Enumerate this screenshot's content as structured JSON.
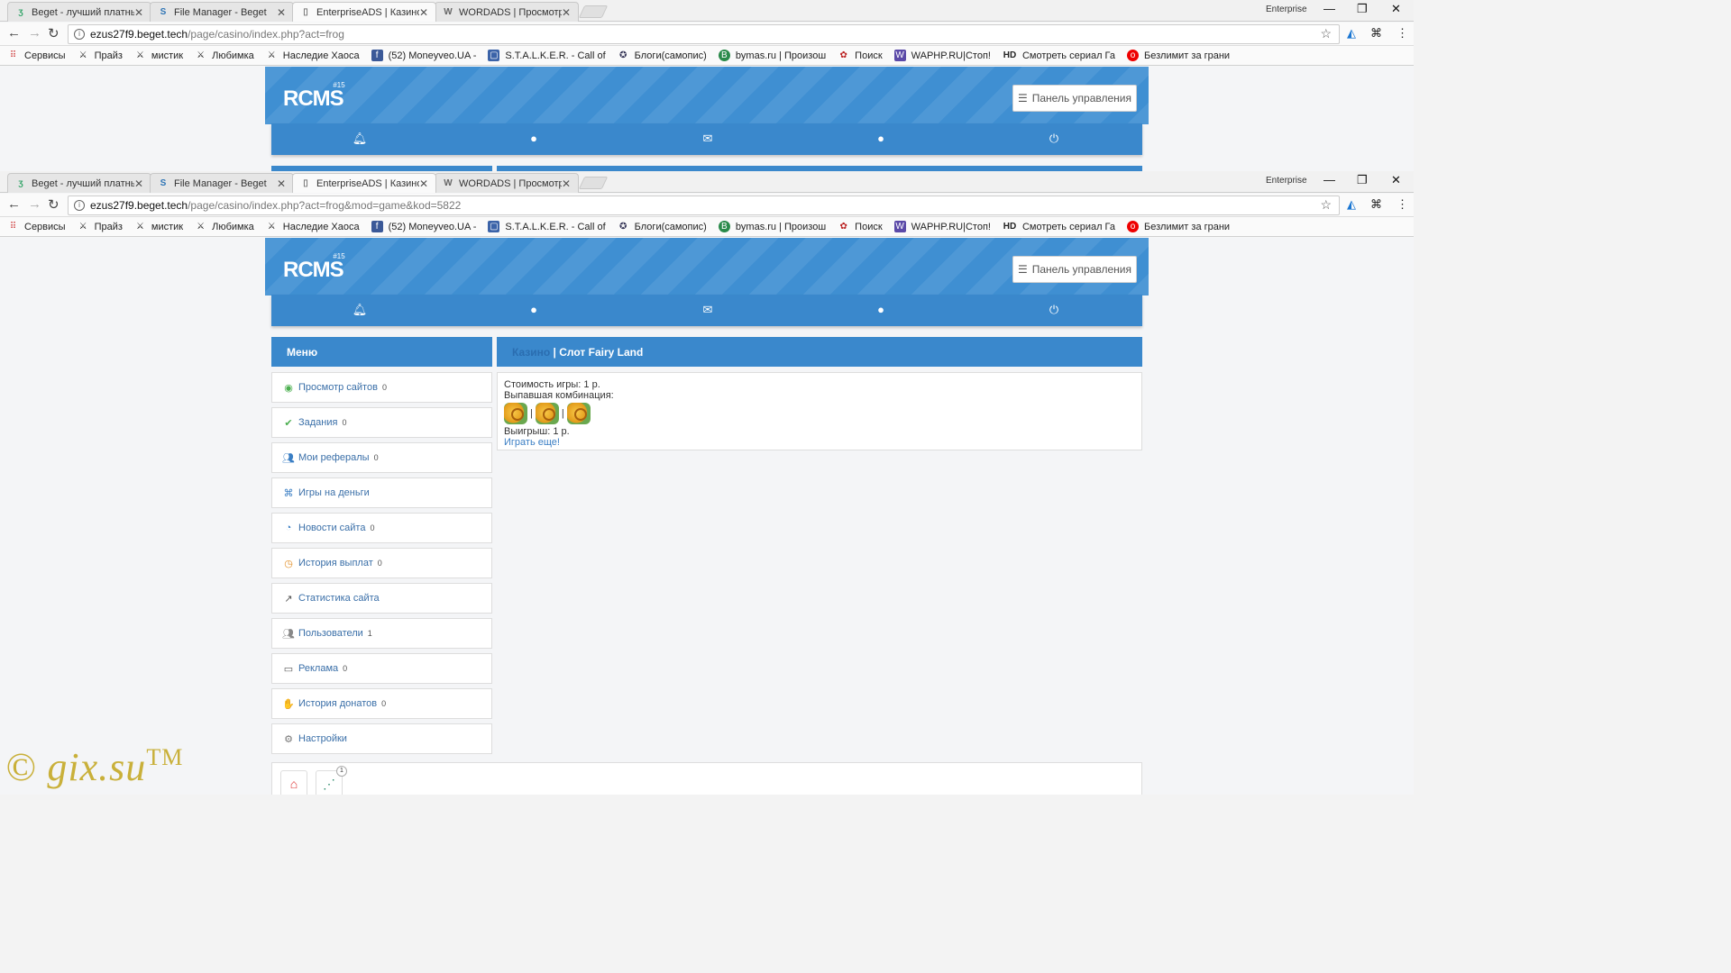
{
  "tabs": [
    {
      "label": "Beget - лучший платный",
      "icon": "beget-icon"
    },
    {
      "label": "File Manager - Beget",
      "icon": "file-manager-icon"
    },
    {
      "label": "EnterpriseADS | Казино",
      "icon": "page-icon"
    },
    {
      "label": "WORDADS | Просмотр т",
      "icon": "wordads-icon"
    }
  ],
  "window": {
    "profile_label": "Enterprise"
  },
  "urls": [
    {
      "host": "ezus27f9.beget.tech",
      "path": "/page/casino/index.php?act=frog"
    },
    {
      "host": "ezus27f9.beget.tech",
      "path": "/page/casino/index.php?act=frog&mod=game&kod=5822"
    }
  ],
  "bookmarks": [
    "Сервисы",
    "Прайз",
    "мистик",
    "Любимка",
    "Наследие Хаоса",
    "(52) Moneyveo.UA -",
    "S.T.A.L.K.E.R. - Call of",
    "Блоги(самопис)",
    "bymas.ru | Произош",
    "Поиск",
    "WAPHP.RU|Стоп!",
    "Смотреть сериал Га",
    "Безлимит за грани"
  ],
  "site": {
    "logo": "RCMS",
    "logo_version": "#15",
    "panel_button": "Панель управления"
  },
  "menu": {
    "title": "Меню",
    "items": [
      {
        "label": "Просмотр сайтов",
        "count": "0",
        "icon": "eye-icon"
      },
      {
        "label": "Задания",
        "count": "0",
        "icon": "check-icon"
      },
      {
        "label": "Мои рефералы",
        "count": "0",
        "icon": "users-icon"
      },
      {
        "label": "Игры на деньги",
        "count": "",
        "icon": "gamepad-icon"
      },
      {
        "label": "Новости сайта",
        "count": "0",
        "icon": "rss-icon"
      },
      {
        "label": "История выплат",
        "count": "0",
        "icon": "history-icon"
      },
      {
        "label": "Статистика сайта",
        "count": "",
        "icon": "chart-icon"
      },
      {
        "label": "Пользователи",
        "count": "1",
        "icon": "people-icon"
      },
      {
        "label": "Реклама",
        "count": "0",
        "icon": "monitor-icon"
      },
      {
        "label": "История донатов",
        "count": "0",
        "icon": "donate-icon"
      },
      {
        "label": "Настройки",
        "count": "",
        "icon": "gear-icon"
      }
    ]
  },
  "content": {
    "crumb": "Казино",
    "title": " | Слот Fairy Land",
    "cost": "Стоимость игры: 1 р.",
    "combo_label": "Выпавшая комбинация:",
    "win": "Выигрыш: 1 р.",
    "again": "Играть еще!"
  },
  "footer": {
    "badge": "1"
  },
  "watermark": {
    "text": "© gix.su",
    "tm": "TM"
  }
}
